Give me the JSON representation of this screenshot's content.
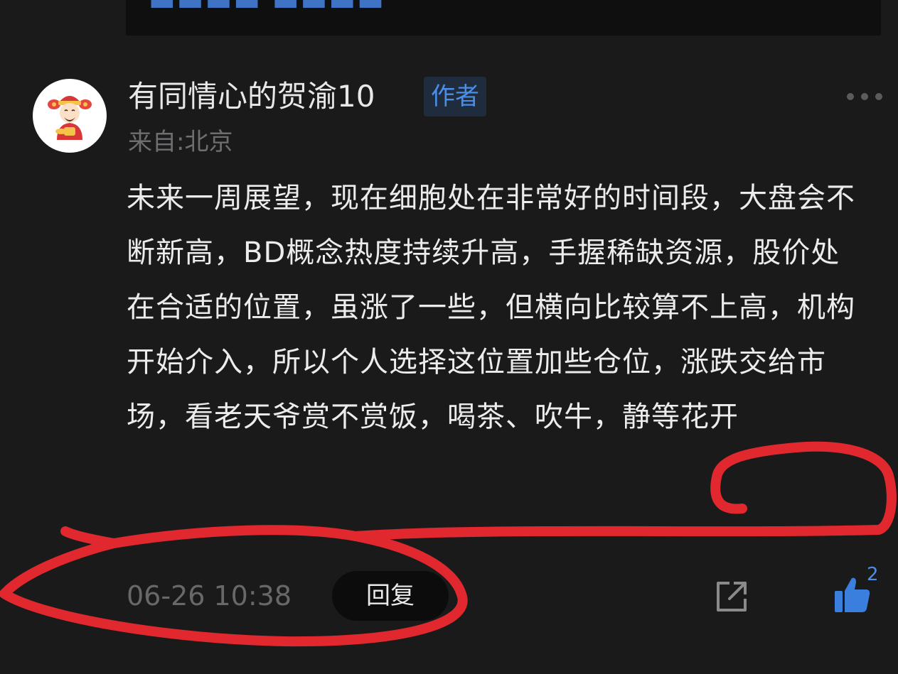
{
  "comment": {
    "username": "有同情心的贺渝10",
    "badge": "作者",
    "location": "来自:北京",
    "text": "未来一周展望，现在细胞处在非常好的时间段，大盘会不断新高，BD概念热度持续升高，手握稀缺资源，股价处在合适的位置，虽涨了一些，但横向比较算不上高，机构开始介入，所以个人选择这位置加些仓位，涨跌交给市场，看老天爷赏不赏饭，喝茶、吹牛，静等花开",
    "timestamp": "06-26 10:38",
    "reply_label": "回复",
    "like_count": "2"
  },
  "icons": {
    "more": "more-dots-icon",
    "share": "share-icon",
    "like": "thumbs-up-icon",
    "avatar": "avatar"
  },
  "colors": {
    "background": "#1a1a1b",
    "accent": "#4a8ee8",
    "annotation": "#e0282e"
  }
}
